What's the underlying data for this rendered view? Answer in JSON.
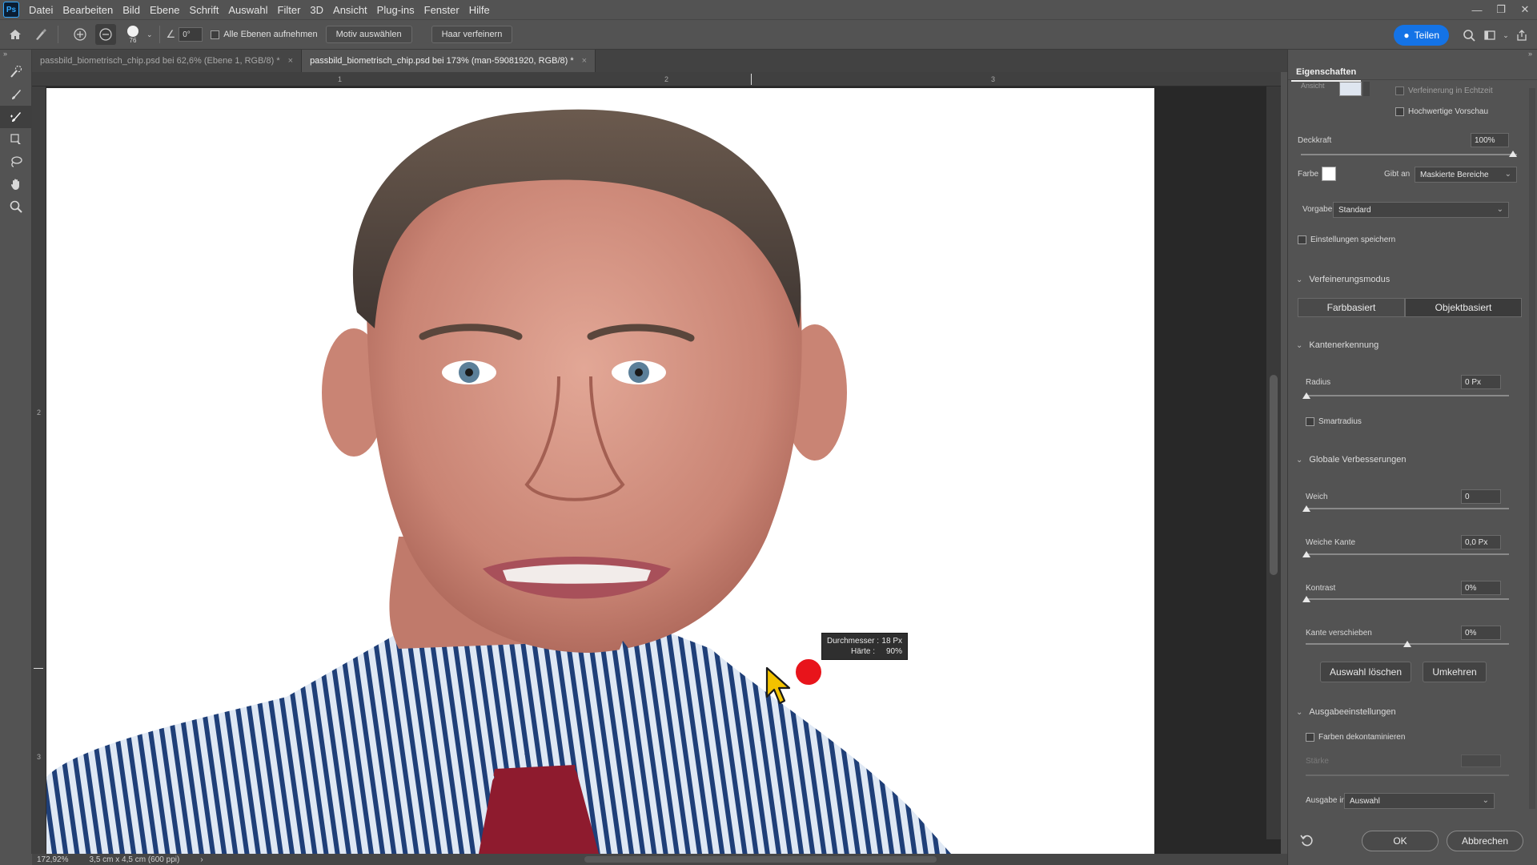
{
  "menubar": {
    "logo": "Ps",
    "items": [
      "Datei",
      "Bearbeiten",
      "Bild",
      "Ebene",
      "Schrift",
      "Auswahl",
      "Filter",
      "3D",
      "Ansicht",
      "Plug-ins",
      "Fenster",
      "Hilfe"
    ]
  },
  "optionsbar": {
    "brush_size": "76",
    "angle": "0°",
    "sample_all_label": "Alle Ebenen aufnehmen",
    "select_subject_label": "Motiv auswählen",
    "refine_hair_label": "Haar verfeinern",
    "share_label": "Teilen"
  },
  "tabs": [
    {
      "label": "passbild_biometrisch_chip.psd bei 62,6% (Ebene 1, RGB/8) *",
      "close": "×"
    },
    {
      "label": "passbild_biometrisch_chip.psd bei 173% (man-59081920, RGB/8) *",
      "close": "×"
    }
  ],
  "rulers": {
    "top": [
      "1",
      "2",
      "3"
    ],
    "left": [
      "2",
      "3"
    ]
  },
  "hud": {
    "diameter_label": "Durchmesser :",
    "diameter_value": "18 Px",
    "hardness_label": "Härte :",
    "hardness_value": "90%"
  },
  "panel": {
    "title": "Eigenschaften",
    "view_label": "Ansicht",
    "realtime_label": "Verfeinerung in Echtzeit",
    "hq_preview_label": "Hochwertige Vorschau",
    "opacity_label": "Deckkraft",
    "opacity_value": "100%",
    "color_label": "Farbe",
    "indicates_label": "Gibt an",
    "indicates_value": "Maskierte Bereiche",
    "preset_label": "Vorgabe",
    "preset_value": "Standard",
    "save_settings_label": "Einstellungen speichern",
    "refine_mode_label": "Verfeinerungsmodus",
    "mode_color": "Farbbasiert",
    "mode_object": "Objektbasiert",
    "edge_detection_label": "Kantenerkennung",
    "radius_label": "Radius",
    "radius_value": "0 Px",
    "smart_radius_label": "Smartradius",
    "global_label": "Globale Verbesserungen",
    "smooth_label": "Weich",
    "smooth_value": "0",
    "feather_label": "Weiche Kante",
    "feather_value": "0,0 Px",
    "contrast_label": "Kontrast",
    "contrast_value": "0%",
    "shift_edge_label": "Kante verschieben",
    "shift_edge_value": "0%",
    "clear_selection_label": "Auswahl löschen",
    "invert_label": "Umkehren",
    "output_settings_label": "Ausgabeeinstellungen",
    "decontaminate_label": "Farben dekontaminieren",
    "amount_label": "Stärke",
    "output_to_label": "Ausgabe in",
    "output_to_value": "Auswahl",
    "ok_label": "OK",
    "cancel_label": "Abbrechen"
  },
  "statusbar": {
    "zoom": "172,92%",
    "doc_size": "3,5 cm x 4,5 cm (600 ppi)"
  },
  "colors": {
    "accent": "#1473e6",
    "brush_dot": "#e8141b",
    "cursor": "#f2c200"
  }
}
